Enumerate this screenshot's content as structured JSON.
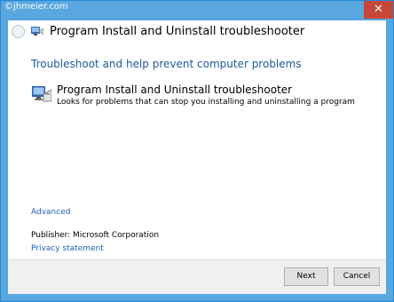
{
  "watermark": "©jhmeier.com",
  "window": {
    "title": "Program Install and Uninstall troubleshooter",
    "close_glyph": "✕"
  },
  "content": {
    "heading": "Troubleshoot and help prevent computer problems",
    "tool": {
      "title": "Program Install and Uninstall troubleshooter",
      "description": "Looks for problems that can stop you installing and uninstalling a program",
      "icon": "troubleshooter-icon"
    },
    "advanced_link": "Advanced",
    "publisher": "Publisher:  Microsoft Corporation",
    "privacy_link": "Privacy statement"
  },
  "footer": {
    "next_label": "Next",
    "cancel_label": "Cancel"
  },
  "colors": {
    "frame": "#5aa7e0",
    "close": "#c7463a",
    "heading": "#1e5a9e",
    "link": "#1e5fb8"
  }
}
